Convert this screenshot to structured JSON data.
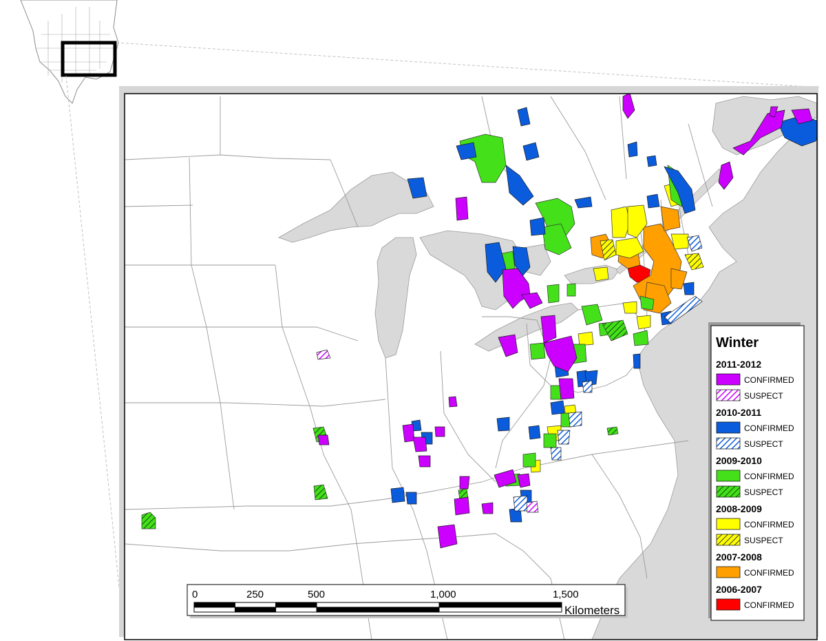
{
  "legend": {
    "title": "Winter",
    "confirmed_label": "CONFIRMED",
    "suspect_label": "SUSPECT",
    "seasons": [
      {
        "season": "2011-2012",
        "color": "#cc00ff",
        "has_suspect": true
      },
      {
        "season": "2010-2011",
        "color": "#0a5cdc",
        "has_suspect": true
      },
      {
        "season": "2009-2010",
        "color": "#44e01a",
        "has_suspect": true
      },
      {
        "season": "2008-2009",
        "color": "#ffff00",
        "has_suspect": true
      },
      {
        "season": "2007-2008",
        "color": "#ff9f00",
        "has_suspect": false
      },
      {
        "season": "2006-2007",
        "color": "#ff0000",
        "has_suspect": false
      }
    ]
  },
  "scale_bar": {
    "ticks": [
      "0",
      "250",
      "500",
      "1,000",
      "1,500"
    ],
    "tick_values_km": [
      0,
      250,
      500,
      1000,
      1500
    ],
    "unit": "Kilometers"
  },
  "colors": {
    "water": "#d9d9d9",
    "land": "#ffffff",
    "border": "#9a9a9a",
    "frame": "#000000"
  }
}
